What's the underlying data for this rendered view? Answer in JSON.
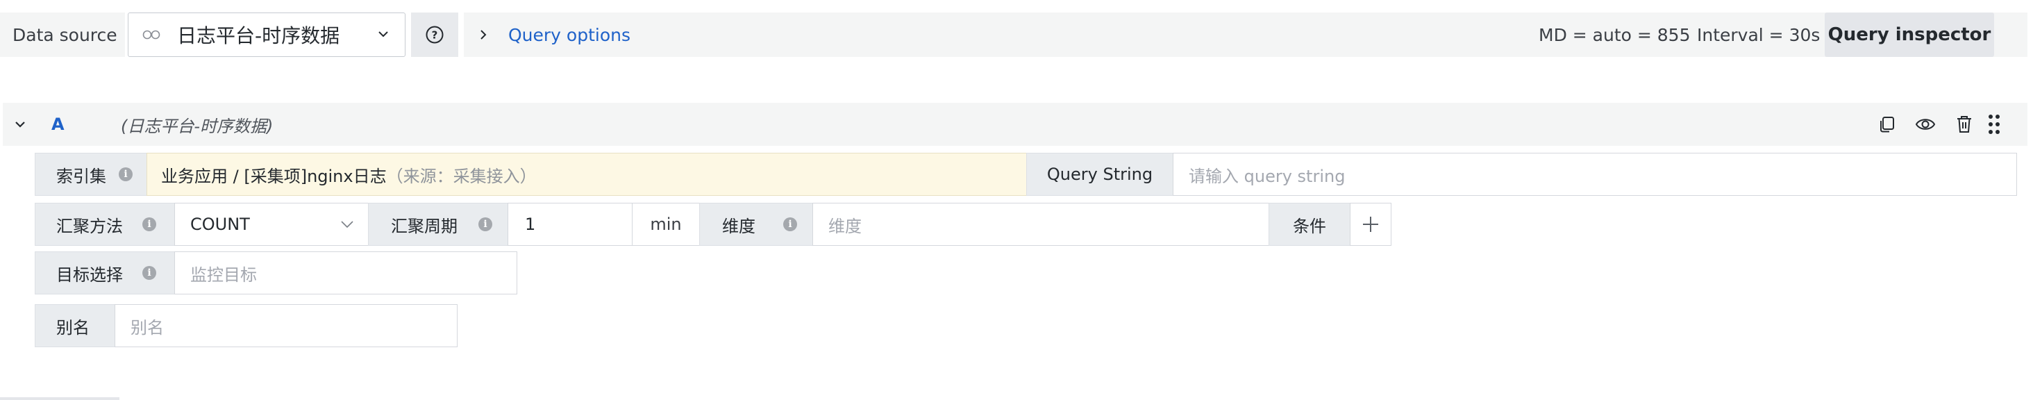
{
  "toolbar": {
    "datasource_label": "Data source",
    "datasource_value": "日志平台-时序数据",
    "query_options": "Query options",
    "md_info": "MD = auto = 855",
    "interval_info": "Interval = 30s",
    "query_inspector": "Query inspector"
  },
  "query": {
    "ref_id": "A",
    "datasource_name": "(日志平台-时序数据)",
    "index_set": {
      "label": "索引集",
      "value": "业务应用 / [采集项]nginx日志",
      "source": "（来源：采集接入）"
    },
    "query_string": {
      "label": "Query String",
      "placeholder": "请输入 query string"
    },
    "aggregation": {
      "label": "汇聚方法",
      "value": "COUNT"
    },
    "period": {
      "label": "汇聚周期",
      "value": "1",
      "unit": "min"
    },
    "dimension": {
      "label": "维度",
      "placeholder": "维度"
    },
    "condition": {
      "label": "条件"
    },
    "target": {
      "label": "目标选择",
      "placeholder": "监控目标"
    },
    "alias": {
      "label": "别名",
      "placeholder": "别名"
    }
  },
  "colors": {
    "link_blue": "#1f62c9",
    "warning_bg": "#fdf8e4",
    "label_bg": "#e9ecef"
  }
}
